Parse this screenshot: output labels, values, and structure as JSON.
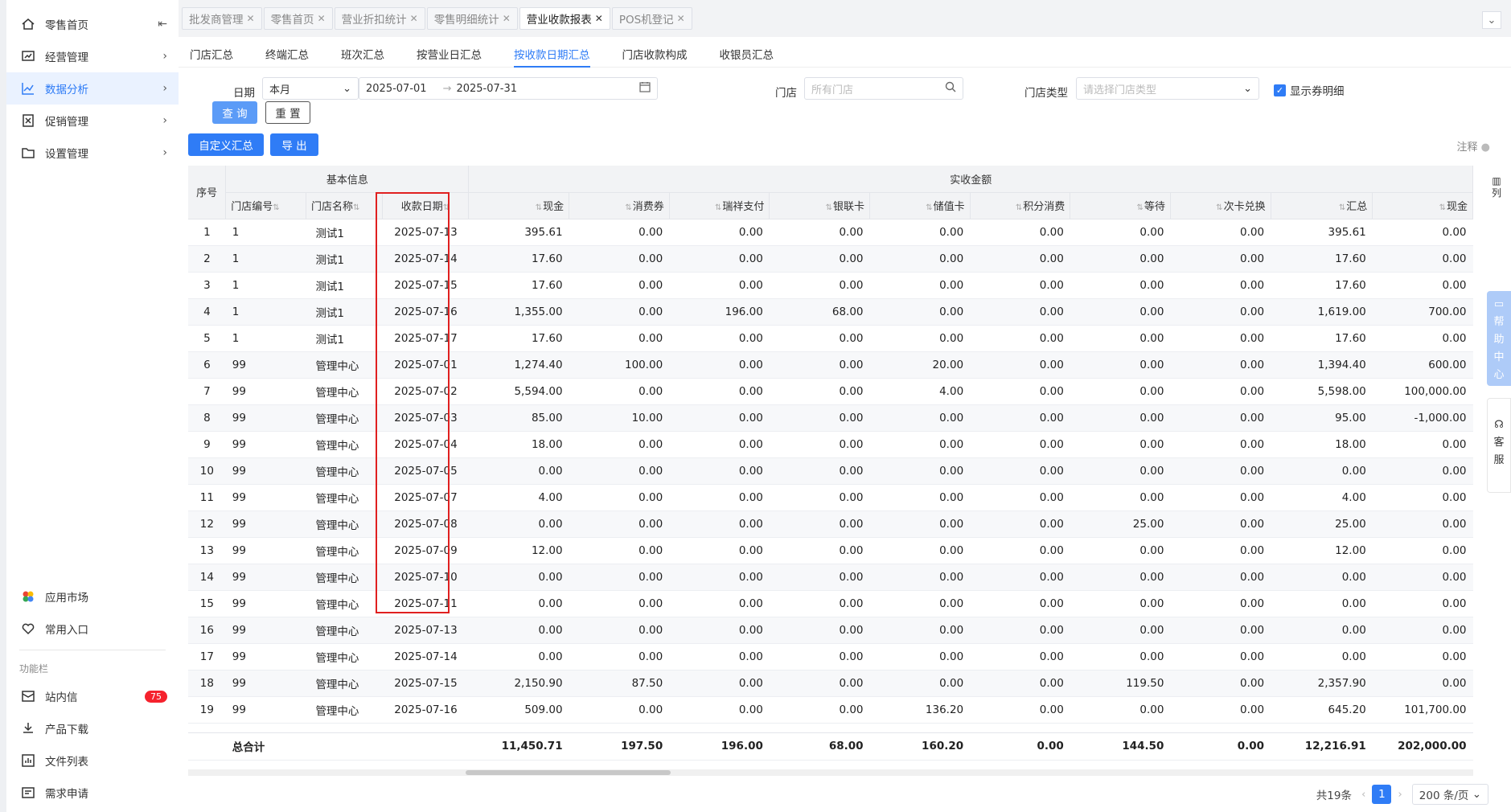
{
  "sidebar": {
    "items": [
      {
        "label": "零售首页",
        "icon": "home-icon"
      },
      {
        "label": "经营管理",
        "icon": "chart-board-icon"
      },
      {
        "label": "数据分析",
        "icon": "line-chart-icon"
      },
      {
        "label": "促销管理",
        "icon": "tag-icon"
      },
      {
        "label": "设置管理",
        "icon": "folder-icon"
      }
    ],
    "bottom": [
      {
        "label": "应用市场",
        "icon": "app-market-icon"
      },
      {
        "label": "常用入口",
        "icon": "heart-icon"
      }
    ],
    "section_title": "功能栏",
    "func_items": [
      {
        "label": "站内信",
        "icon": "mail-icon",
        "badge": "75"
      },
      {
        "label": "产品下载",
        "icon": "download-icon"
      },
      {
        "label": "文件列表",
        "icon": "file-list-icon"
      },
      {
        "label": "需求申请",
        "icon": "request-icon"
      }
    ]
  },
  "tabs": [
    "批发商管理",
    "零售首页",
    "营业折扣统计",
    "零售明细统计",
    "营业收款报表",
    "POS机登记"
  ],
  "subtabs": [
    "门店汇总",
    "终端汇总",
    "班次汇总",
    "按营业日汇总",
    "按收款日期汇总",
    "门店收款构成",
    "收银员汇总"
  ],
  "filters": {
    "date_label": "日期",
    "date_range_select": "本月",
    "date_start": "2025-07-01",
    "date_end": "2025-07-31",
    "store_label": "门店",
    "store_placeholder": "所有门店",
    "store_type_label": "门店类型",
    "store_type_placeholder": "请选择门店类型",
    "show_coupon_label": "显示券明细"
  },
  "buttons": {
    "query": "查 询",
    "reset": "重 置",
    "custom_summary": "自定义汇总",
    "export": "导 出"
  },
  "note_label": "注释",
  "table": {
    "group_basic": "基本信息",
    "group_amount": "实收金额",
    "seq_header": "序号",
    "columns": [
      "门店编号",
      "门店名称",
      "收款日期",
      "现金",
      "消费券",
      "瑞祥支付",
      "银联卡",
      "储值卡",
      "积分消费",
      "等待",
      "次卡兑换",
      "汇总",
      "现金"
    ],
    "rows": [
      [
        "1",
        "1",
        "测试1",
        "2025-07-13",
        "395.61",
        "0.00",
        "0.00",
        "0.00",
        "0.00",
        "0.00",
        "0.00",
        "0.00",
        "395.61",
        "0.00"
      ],
      [
        "2",
        "1",
        "测试1",
        "2025-07-14",
        "17.60",
        "0.00",
        "0.00",
        "0.00",
        "0.00",
        "0.00",
        "0.00",
        "0.00",
        "17.60",
        "0.00"
      ],
      [
        "3",
        "1",
        "测试1",
        "2025-07-15",
        "17.60",
        "0.00",
        "0.00",
        "0.00",
        "0.00",
        "0.00",
        "0.00",
        "0.00",
        "17.60",
        "0.00"
      ],
      [
        "4",
        "1",
        "测试1",
        "2025-07-16",
        "1,355.00",
        "0.00",
        "196.00",
        "68.00",
        "0.00",
        "0.00",
        "0.00",
        "0.00",
        "1,619.00",
        "700.00"
      ],
      [
        "5",
        "1",
        "测试1",
        "2025-07-17",
        "17.60",
        "0.00",
        "0.00",
        "0.00",
        "0.00",
        "0.00",
        "0.00",
        "0.00",
        "17.60",
        "0.00"
      ],
      [
        "6",
        "99",
        "管理中心",
        "2025-07-01",
        "1,274.40",
        "100.00",
        "0.00",
        "0.00",
        "20.00",
        "0.00",
        "0.00",
        "0.00",
        "1,394.40",
        "600.00"
      ],
      [
        "7",
        "99",
        "管理中心",
        "2025-07-02",
        "5,594.00",
        "0.00",
        "0.00",
        "0.00",
        "4.00",
        "0.00",
        "0.00",
        "0.00",
        "5,598.00",
        "100,000.00"
      ],
      [
        "8",
        "99",
        "管理中心",
        "2025-07-03",
        "85.00",
        "10.00",
        "0.00",
        "0.00",
        "0.00",
        "0.00",
        "0.00",
        "0.00",
        "95.00",
        "-1,000.00"
      ],
      [
        "9",
        "99",
        "管理中心",
        "2025-07-04",
        "18.00",
        "0.00",
        "0.00",
        "0.00",
        "0.00",
        "0.00",
        "0.00",
        "0.00",
        "18.00",
        "0.00"
      ],
      [
        "10",
        "99",
        "管理中心",
        "2025-07-05",
        "0.00",
        "0.00",
        "0.00",
        "0.00",
        "0.00",
        "0.00",
        "0.00",
        "0.00",
        "0.00",
        "0.00"
      ],
      [
        "11",
        "99",
        "管理中心",
        "2025-07-07",
        "4.00",
        "0.00",
        "0.00",
        "0.00",
        "0.00",
        "0.00",
        "0.00",
        "0.00",
        "4.00",
        "0.00"
      ],
      [
        "12",
        "99",
        "管理中心",
        "2025-07-08",
        "0.00",
        "0.00",
        "0.00",
        "0.00",
        "0.00",
        "0.00",
        "25.00",
        "0.00",
        "25.00",
        "0.00"
      ],
      [
        "13",
        "99",
        "管理中心",
        "2025-07-09",
        "12.00",
        "0.00",
        "0.00",
        "0.00",
        "0.00",
        "0.00",
        "0.00",
        "0.00",
        "12.00",
        "0.00"
      ],
      [
        "14",
        "99",
        "管理中心",
        "2025-07-10",
        "0.00",
        "0.00",
        "0.00",
        "0.00",
        "0.00",
        "0.00",
        "0.00",
        "0.00",
        "0.00",
        "0.00"
      ],
      [
        "15",
        "99",
        "管理中心",
        "2025-07-11",
        "0.00",
        "0.00",
        "0.00",
        "0.00",
        "0.00",
        "0.00",
        "0.00",
        "0.00",
        "0.00",
        "0.00"
      ],
      [
        "16",
        "99",
        "管理中心",
        "2025-07-13",
        "0.00",
        "0.00",
        "0.00",
        "0.00",
        "0.00",
        "0.00",
        "0.00",
        "0.00",
        "0.00",
        "0.00"
      ],
      [
        "17",
        "99",
        "管理中心",
        "2025-07-14",
        "0.00",
        "0.00",
        "0.00",
        "0.00",
        "0.00",
        "0.00",
        "0.00",
        "0.00",
        "0.00",
        "0.00"
      ],
      [
        "18",
        "99",
        "管理中心",
        "2025-07-15",
        "2,150.90",
        "87.50",
        "0.00",
        "0.00",
        "0.00",
        "0.00",
        "119.50",
        "0.00",
        "2,357.90",
        "0.00"
      ],
      [
        "19",
        "99",
        "管理中心",
        "2025-07-16",
        "509.00",
        "0.00",
        "0.00",
        "0.00",
        "136.20",
        "0.00",
        "0.00",
        "0.00",
        "645.20",
        "101,700.00"
      ]
    ],
    "total_label": "总合计",
    "totals": [
      "11,450.71",
      "197.50",
      "196.00",
      "68.00",
      "160.20",
      "0.00",
      "144.50",
      "0.00",
      "12,216.91",
      "202,000.00"
    ]
  },
  "pagination": {
    "total": "共19条",
    "current": "1",
    "page_size": "200 条/页"
  },
  "side_float": {
    "columns_label": "列",
    "help_label": "帮助中心",
    "service_label": "客服"
  },
  "colors": {
    "primary": "#2f7cf6",
    "highlight_border": "#e02020",
    "badge": "#f5222d"
  }
}
